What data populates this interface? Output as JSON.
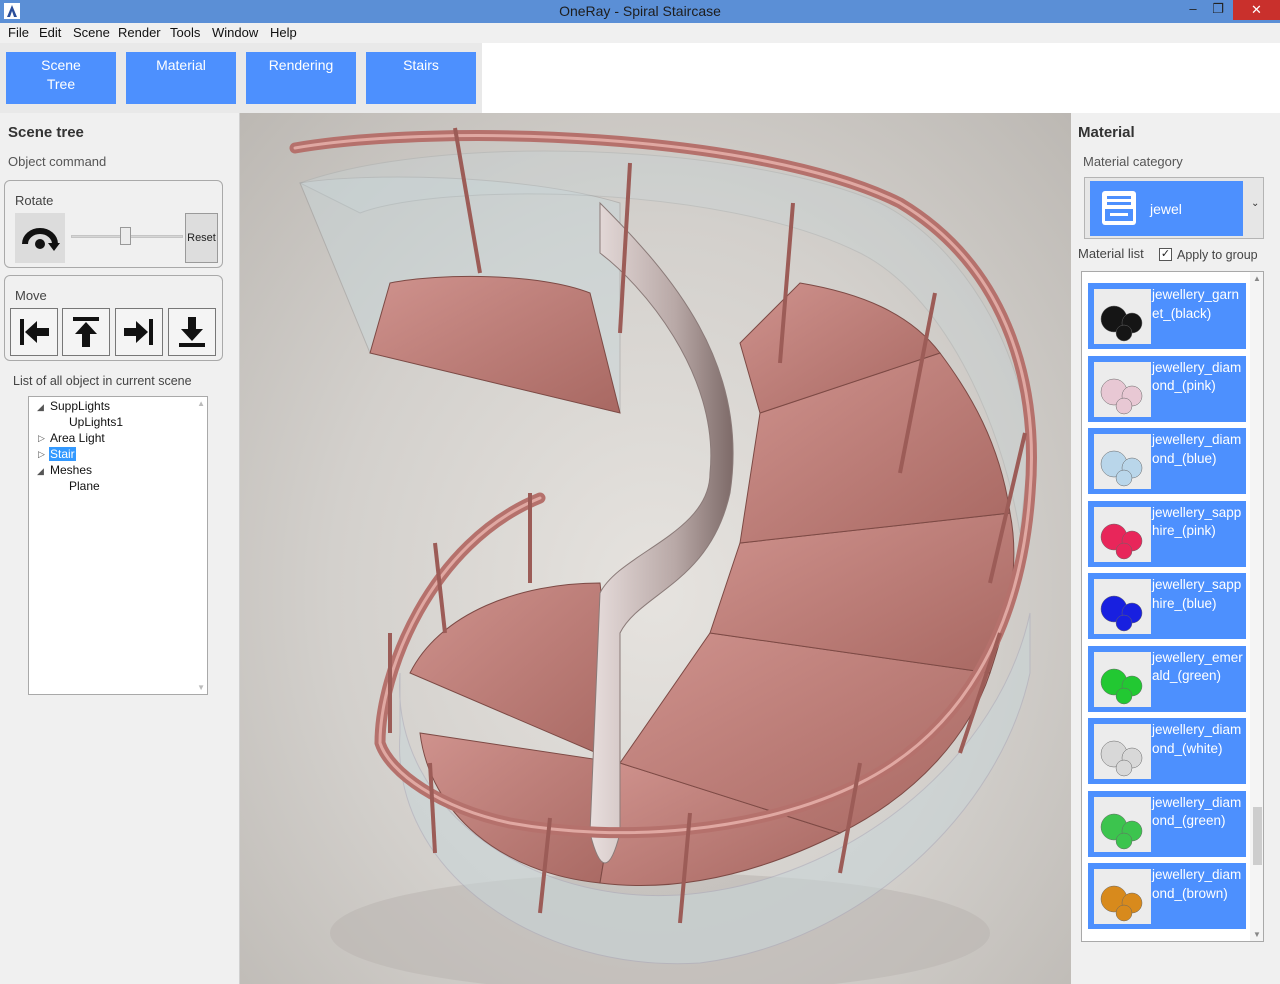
{
  "window": {
    "title": "OneRay - Spiral Staircase",
    "minimize": "–",
    "maximize": "❐",
    "close": "✕"
  },
  "menu": [
    "File",
    "Edit",
    "Scene",
    "Render",
    "Tools",
    "Window",
    "Help"
  ],
  "ribbon": {
    "buttons": [
      "Scene\nTree",
      "Material",
      "Rendering",
      "Stairs"
    ]
  },
  "scene_panel": {
    "title": "Scene tree",
    "subtitle": "Object command",
    "rotate": {
      "label": "Rotate",
      "reset_label": "Reset",
      "slider_value": 0.5
    },
    "move": {
      "label": "Move",
      "buttons": [
        "move-left-icon",
        "move-up-icon",
        "move-right-icon",
        "move-down-icon"
      ]
    },
    "list_label": "List of all object in current scene",
    "tree": [
      {
        "label": "SuppLights",
        "expander": "◢",
        "level": 0
      },
      {
        "label": "UpLights1",
        "expander": "",
        "level": 1
      },
      {
        "label": "Area Light",
        "expander": "▷",
        "level": 0
      },
      {
        "label": "Stair",
        "expander": "▷",
        "level": 0,
        "selected": true
      },
      {
        "label": "Meshes",
        "expander": "◢",
        "level": 0
      },
      {
        "label": "Plane",
        "expander": "",
        "level": 1
      }
    ]
  },
  "material_panel": {
    "title": "Material",
    "category_label": "Material category",
    "category_value": "jewel",
    "dropdown_arrow": "⌄",
    "list_label": "Material list",
    "apply_to_group": "Apply to group",
    "apply_checked": "✓",
    "items": [
      {
        "label": "jewellery_garnet_(black)",
        "gem_color": "#151515"
      },
      {
        "label": "jewellery_diamond_(pink)",
        "gem_color": "#e8c8d4"
      },
      {
        "label": "jewellery_diamond_(blue)",
        "gem_color": "#b9d6ea"
      },
      {
        "label": "jewellery_sapphire_(pink)",
        "gem_color": "#e8265a"
      },
      {
        "label": "jewellery_sapphire_(blue)",
        "gem_color": "#1820e0"
      },
      {
        "label": "jewellery_emerald_(green)",
        "gem_color": "#22c832"
      },
      {
        "label": "jewellery_diamond_(white)",
        "gem_color": "#d8d8d8"
      },
      {
        "label": "jewellery_diamond_(green)",
        "gem_color": "#3cc44e"
      },
      {
        "label": "jewellery_diamond_(brown)",
        "gem_color": "#d88a1c"
      }
    ]
  },
  "colors": {
    "accent": "#4d90fe",
    "titlebar": "#5b8fd6",
    "close": "#c9302c",
    "stair": "#c98a86",
    "glass": "#c9d6d9"
  }
}
